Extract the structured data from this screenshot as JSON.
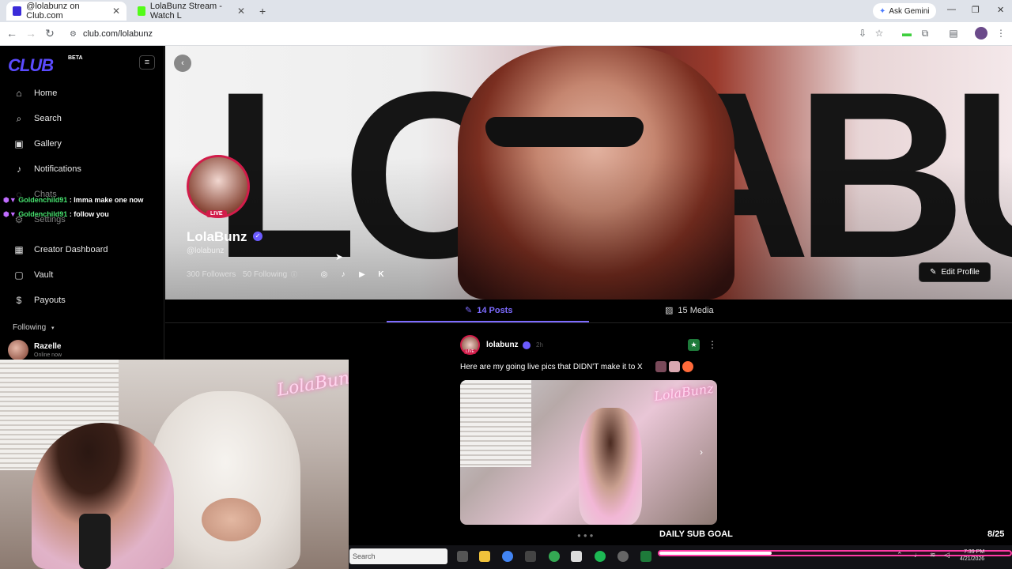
{
  "browser": {
    "tabs": [
      {
        "label": "@lolabunz on Club.com",
        "active": true
      },
      {
        "label": "LolaBunz Stream - Watch L",
        "active": false
      }
    ],
    "new_tab": "+",
    "url": "club.com/lolabunz",
    "ask_gemini": "Ask Gemini"
  },
  "sidebar": {
    "logo": "CLUB",
    "beta": "BETA",
    "items": [
      {
        "label": "Home",
        "icon": "home-icon"
      },
      {
        "label": "Search",
        "icon": "search-icon"
      },
      {
        "label": "Gallery",
        "icon": "gallery-icon"
      },
      {
        "label": "Notifications",
        "icon": "bell-icon"
      },
      {
        "label": "Chats",
        "icon": "chat-icon"
      },
      {
        "label": "Settings",
        "icon": "gear-icon"
      },
      {
        "label": "Creator Dashboard",
        "icon": "dashboard-icon"
      },
      {
        "label": "Vault",
        "icon": "vault-icon"
      },
      {
        "label": "Payouts",
        "icon": "dollar-icon"
      }
    ],
    "following_label": "Following",
    "following_user": {
      "name": "Razelle",
      "status": "Online now"
    }
  },
  "chat_overlay": [
    {
      "user": "Goldenchild91",
      "message": ": Imma make one now"
    },
    {
      "user": "Goldenchild91",
      "message": ": follow you"
    }
  ],
  "profile": {
    "banner_text": "LOLABUNZ",
    "name": "LolaBunz",
    "handle": "@lolabunz",
    "live": "LIVE",
    "followers": "300 Followers",
    "following": "50 Following",
    "edit_button": "Edit Profile"
  },
  "tabs": {
    "posts": "14 Posts",
    "media": "15 Media"
  },
  "post": {
    "user": "lolabunz",
    "time": "2h",
    "live": "LIVE",
    "text": "Here are my going live pics that DIDN'T make it to X",
    "image_text": "LolaBunz"
  },
  "webcam": {
    "neon_sign": "LolaBunz"
  },
  "sub_goal": {
    "label": "DAILY SUB GOAL",
    "count": "8/25",
    "progress": 0.32
  },
  "taskbar": {
    "search": "Search",
    "time": "7:39 PM",
    "date": "4/21/2026"
  },
  "colors": {
    "accent": "#7d6bff",
    "live": "#d21c4a",
    "chat_name": "#46e06e",
    "goal_border": "#ff3ba5"
  }
}
